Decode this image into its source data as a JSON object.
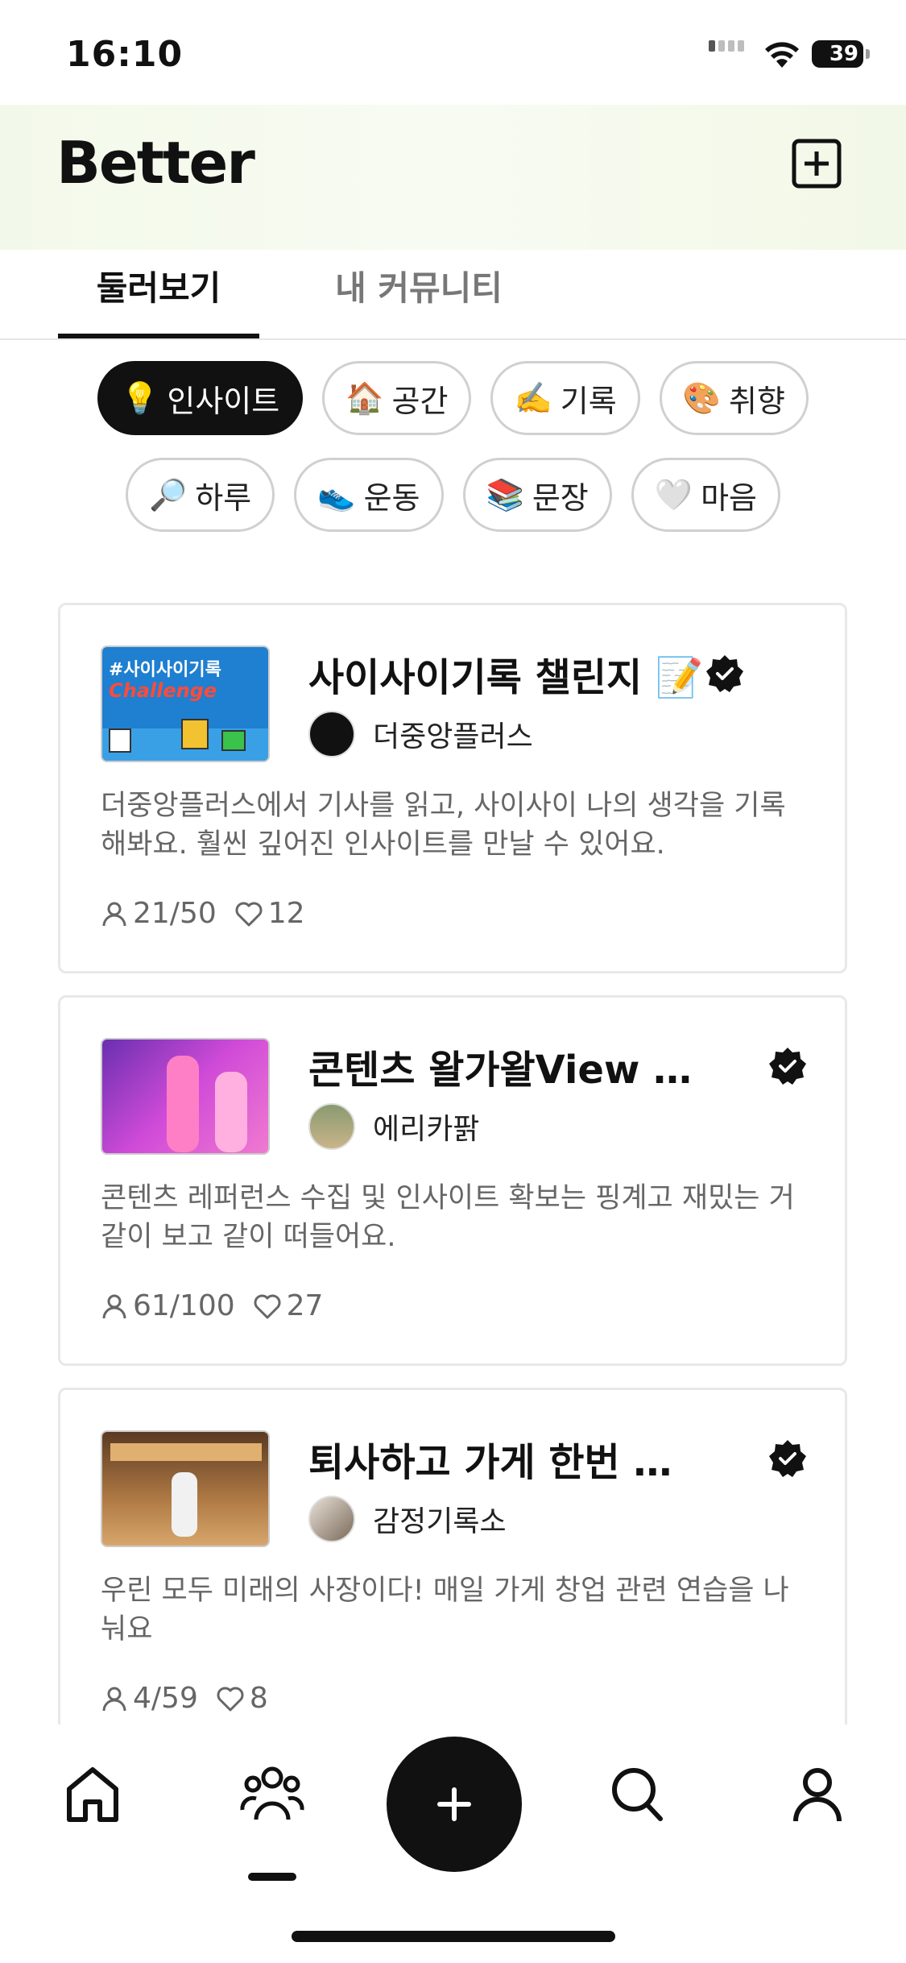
{
  "status_bar": {
    "time": "16:10",
    "battery": "39"
  },
  "header": {
    "logo": "Better"
  },
  "tabs": [
    {
      "label": "둘러보기"
    },
    {
      "label": "내 커뮤니티"
    }
  ],
  "categories": [
    {
      "emoji": "💡",
      "label": "인사이트"
    },
    {
      "emoji": "🏠",
      "label": "공간"
    },
    {
      "emoji": "✍️",
      "label": "기록"
    },
    {
      "emoji": "🎨",
      "label": "취향"
    },
    {
      "emoji": "🔎",
      "label": "하루"
    },
    {
      "emoji": "👟",
      "label": "운동"
    },
    {
      "emoji": "📚",
      "label": "문장"
    },
    {
      "emoji": "🤍",
      "label": "마음"
    }
  ],
  "communities": [
    {
      "title": "사이사이기록 챌린지 📝",
      "owner": "더중앙플러스",
      "thumb_text": "#사이사이기록",
      "thumb_sub": "Challenge",
      "description": "더중앙플러스에서 기사를 읽고, 사이사이 나의 생각을 기록해봐요. 훨씬 깊어진 인사이트를 만날 수 있어요.",
      "members": "21/50",
      "likes": "12"
    },
    {
      "title": "콘텐츠 왈가왈View 커뮤니티",
      "owner": "에리카팕",
      "description": "콘텐츠 레퍼런스 수집 및 인사이트 확보는 핑계고 재밌는 거 같이 보고 같이 떠들어요.",
      "members": "61/100",
      "likes": "27"
    },
    {
      "title": "퇴사하고 가게 한번 차려보자",
      "owner": "감정기록소",
      "description": "우린 모두 미래의 사장이다! 매일 가게 창업 관련 연습을 나눠요",
      "members": "4/59",
      "likes": "8"
    }
  ]
}
